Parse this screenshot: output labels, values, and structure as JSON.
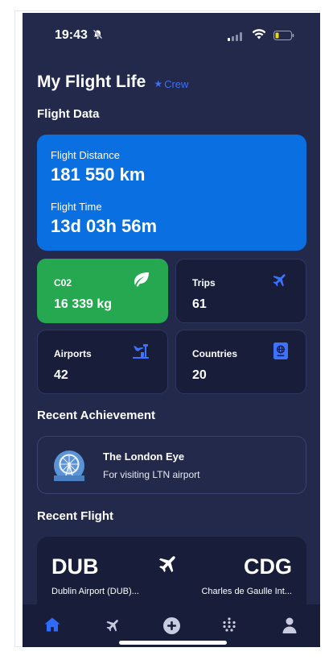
{
  "status_bar": {
    "time": "19:43"
  },
  "header": {
    "title": "My Flight Life",
    "badge": "Crew"
  },
  "sections": {
    "flight_data": "Flight Data",
    "recent_achievement": "Recent Achievement",
    "recent_flight": "Recent Flight"
  },
  "hero": {
    "distance_label": "Flight Distance",
    "distance_value": "181 550 km",
    "time_label": "Flight Time",
    "time_value": "13d 03h 56m"
  },
  "tiles": {
    "co2": {
      "label": "C02",
      "value": "16 339 kg",
      "icon": "leaf-icon"
    },
    "trips": {
      "label": "Trips",
      "value": "61",
      "icon": "plane-icon"
    },
    "airports": {
      "label": "Airports",
      "value": "42",
      "icon": "airport-icon"
    },
    "countries": {
      "label": "Countries",
      "value": "20",
      "icon": "passport-icon"
    }
  },
  "achievement": {
    "title": "The London Eye",
    "subtitle": "For visiting LTN airport",
    "icon": "london-eye-icon"
  },
  "recent_flight": {
    "from_code": "DUB",
    "from_name": "Dublin Airport (DUB)...",
    "to_code": "CDG",
    "to_name": "Charles de Gaulle Int..."
  },
  "tabbar": {
    "tabs": [
      "home",
      "flights",
      "add",
      "stats",
      "profile"
    ],
    "active": "home"
  },
  "colors": {
    "background": "#22294b",
    "card": "#181d3a",
    "accent": "#0a6fe0",
    "green": "#25a84f",
    "tab_active": "#2f6bff"
  }
}
